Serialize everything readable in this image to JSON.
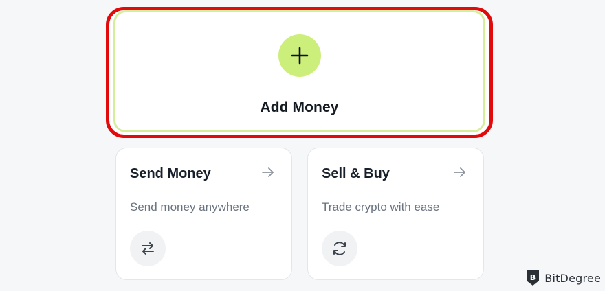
{
  "add_money": {
    "label": "Add Money",
    "icon": "plus-icon"
  },
  "cards": [
    {
      "title": "Send Money",
      "subtitle": "Send money anywhere",
      "arrow_icon": "arrow-right-icon",
      "icon": "swap-arrows-icon"
    },
    {
      "title": "Sell & Buy",
      "subtitle": "Trade crypto with ease",
      "arrow_icon": "arrow-right-icon",
      "icon": "refresh-icon"
    }
  ],
  "watermark": {
    "text": "BitDegree",
    "icon": "bitdegree-shield-logo"
  },
  "colors": {
    "highlight": "#e10b0b",
    "accent": "#ccef7b",
    "accent_border": "#d4ee9b",
    "background": "#f6f7f9"
  }
}
